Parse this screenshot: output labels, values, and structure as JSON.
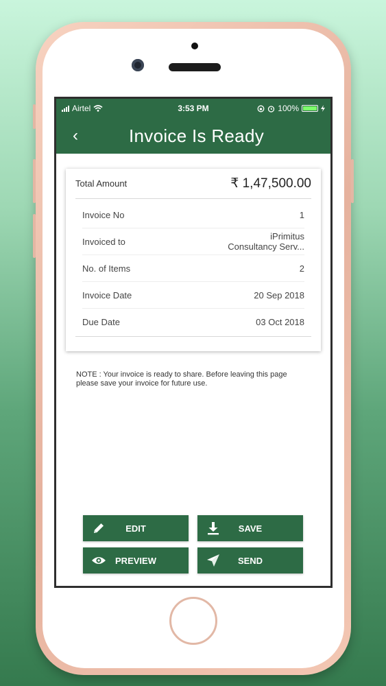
{
  "status_bar": {
    "carrier": "Airtel",
    "time": "3:53 PM",
    "battery": "100%"
  },
  "app_bar": {
    "back_label": "‹",
    "title": "Invoice Is Ready"
  },
  "summary": {
    "total_label": "Total Amount",
    "total_value": "₹ 1,47,500.00",
    "rows": [
      {
        "label": "Invoice No",
        "value": "1"
      },
      {
        "label": "Invoiced to",
        "value_line1": "iPrimitus",
        "value_line2": "Consultancy Serv..."
      },
      {
        "label": "No. of Items",
        "value": "2"
      },
      {
        "label": "Invoice Date",
        "value": "20 Sep 2018"
      },
      {
        "label": "Due Date",
        "value": "03 Oct 2018"
      }
    ]
  },
  "note": "NOTE : Your invoice is ready to share. Before leaving this page please save your invoice for future use.",
  "actions": {
    "edit": "EDIT",
    "save": "SAVE",
    "preview": "PREVIEW",
    "send": "SEND"
  },
  "colors": {
    "primary": "#2d6b45",
    "background_top": "#c9f5dc",
    "background_bottom": "#357a4e"
  },
  "icons": {
    "edit": "pencil-icon",
    "save": "download-icon",
    "preview": "eye-icon",
    "send": "paper-plane-icon"
  }
}
